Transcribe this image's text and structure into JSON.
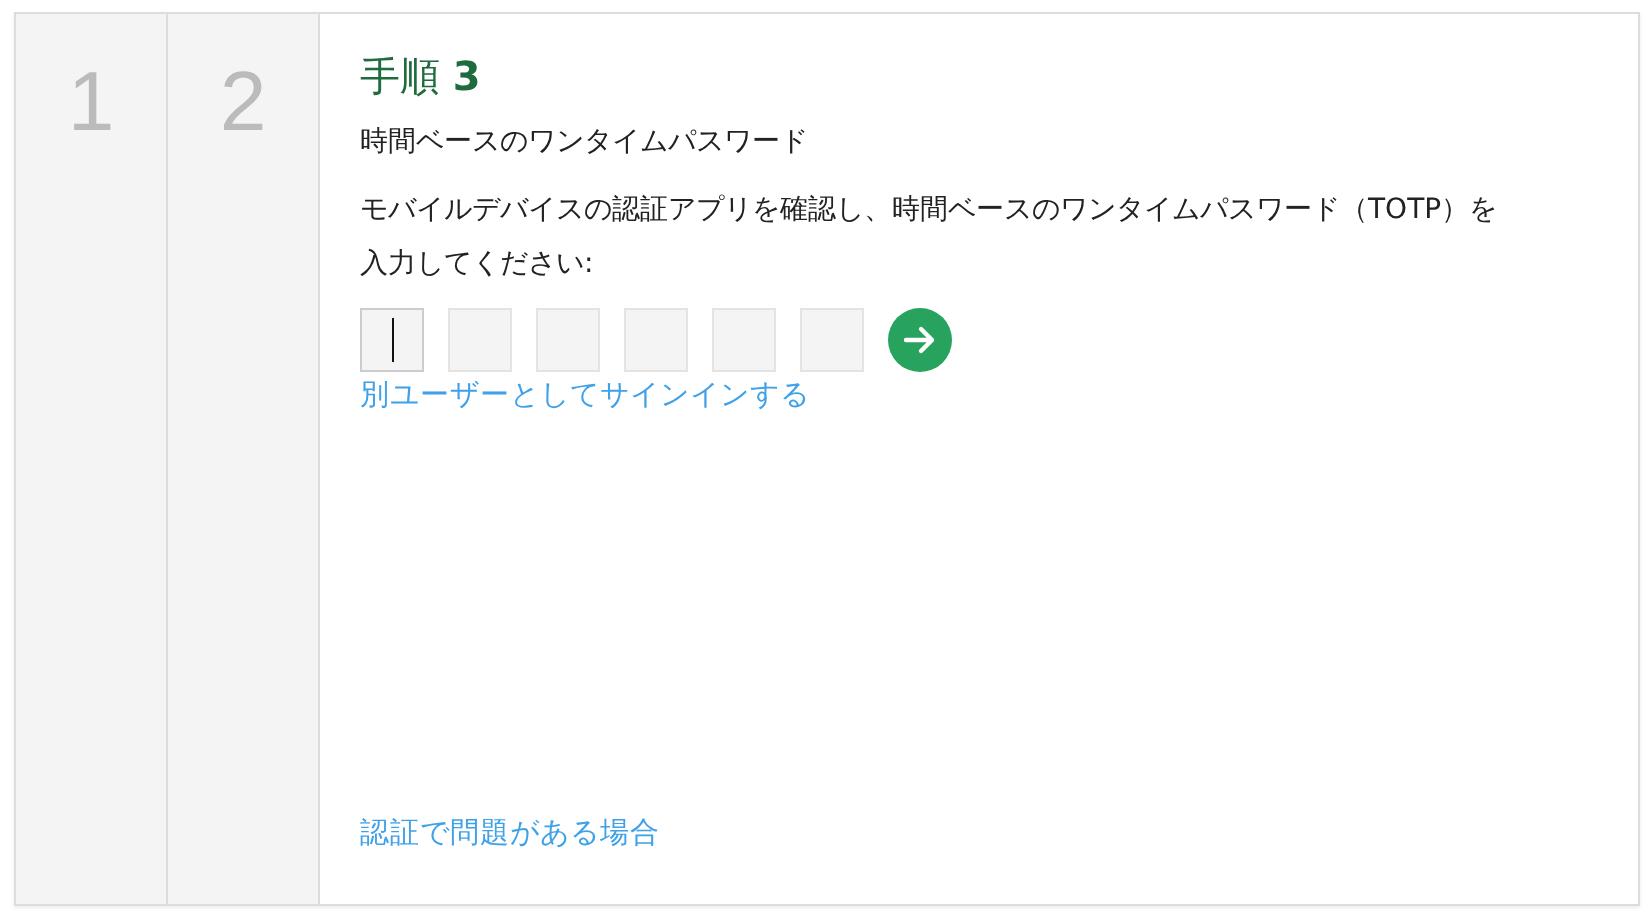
{
  "steps": [
    {
      "label": "1"
    },
    {
      "label": "2"
    }
  ],
  "title": "手順 **3**",
  "subtitle": "時間ベースのワンタイムパスワード",
  "description": "モバイルデバイスの認証アプリを確認し、時間ベースのワンタイムパスワード（TOTP）を入力してください:",
  "code_fields": [
    {
      "focused": true
    },
    {
      "focused": false
    },
    {
      "focused": false
    },
    {
      "focused": false
    },
    {
      "focused": false
    },
    {
      "focused": false
    }
  ],
  "switch_user_link": "別ユーザーとしてサインインする",
  "trouble_link": "認証で問題がある場合"
}
